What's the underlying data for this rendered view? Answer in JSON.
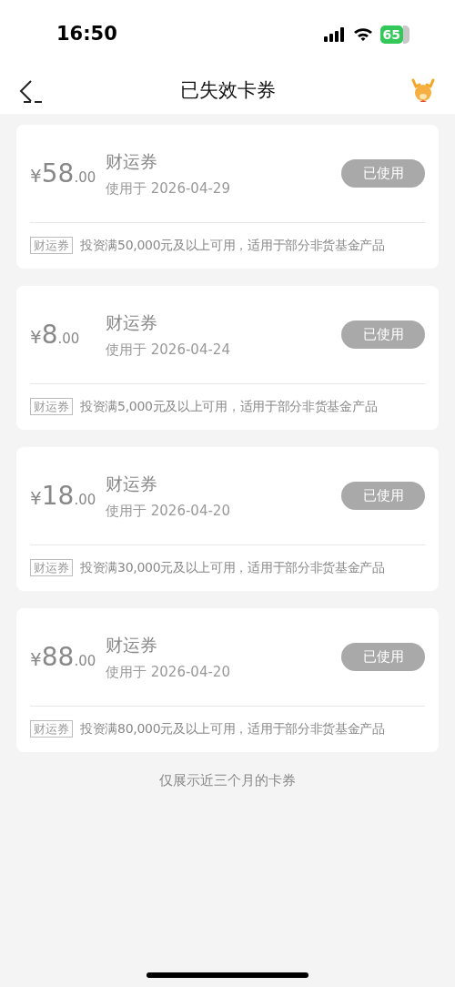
{
  "status_bar": {
    "time": "16:50",
    "battery": "65"
  },
  "header": {
    "title": "已失效卡券"
  },
  "coupons": [
    {
      "currency": "¥",
      "amount": "58",
      "decimals": ".00",
      "name": "财运券",
      "used_on": "使用于 2026-04-29",
      "status": "已使用",
      "tag": "财运券",
      "condition": "投资满50,000元及以上可用，适用于部分非货基金产品"
    },
    {
      "currency": "¥",
      "amount": "8",
      "decimals": ".00",
      "name": "财运券",
      "used_on": "使用于 2026-04-24",
      "status": "已使用",
      "tag": "财运券",
      "condition": "投资满5,000元及以上可用，适用于部分非货基金产品"
    },
    {
      "currency": "¥",
      "amount": "18",
      "decimals": ".00",
      "name": "财运券",
      "used_on": "使用于 2026-04-20",
      "status": "已使用",
      "tag": "财运券",
      "condition": "投资满30,000元及以上可用，适用于部分非货基金产品"
    },
    {
      "currency": "¥",
      "amount": "88",
      "decimals": ".00",
      "name": "财运券",
      "used_on": "使用于 2026-04-20",
      "status": "已使用",
      "tag": "财运券",
      "condition": "投资满80,000元及以上可用，适用于部分非货基金产品"
    }
  ],
  "footer_note": "仅展示近三个月的卡券"
}
